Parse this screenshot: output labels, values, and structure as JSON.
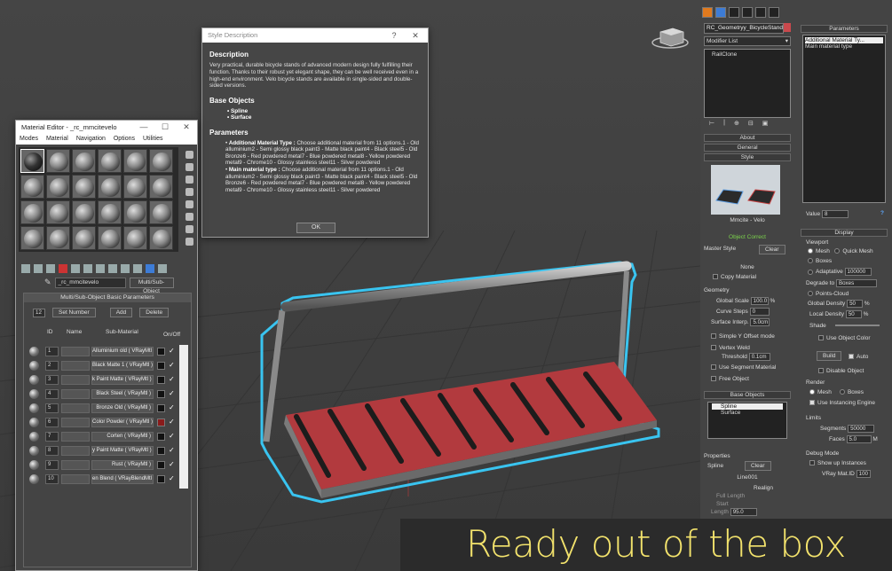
{
  "style_dialog": {
    "title": "Style Description",
    "help": "?",
    "close": "✕",
    "description_heading": "Description",
    "description": "Very practical, durable bicycle stands of advanced modern design fully fulfilling their function. Thanks to their robust yet elegant shape, they can be well received even in a high-end environment. Velo bicycle stands are available in single-sided and double-sided versions.",
    "base_objects_heading": "Base Objects",
    "base_objects": [
      "Spline",
      "Surface"
    ],
    "parameters_heading": "Parameters",
    "param1_name": "Additional Material Type :",
    "param1_text": " Choose additional material from 11 options.1 - Old alluminium2 - Semi glossy black paint3 - Matte black paint4 - Black steel5 - Old Bronze6 - Red powdered metal7 - Blue powdered metal8 - Yellow powdered metal9 - Chrome10 - Glossy stainless steel11 - Silver powdered",
    "param2_name": "Main material type :",
    "param2_text": " Choose additional material from 11 options.1 - Old alluminium2 - Semi glossy black paint3 - Matte black paint4 - Black steel5 - Old Bronze6 - Red powdered metal7 - Blue powdered metal8 - Yellow powdered metal9 - Chrome10 - Glossy stainless steel11 - Silver powdered",
    "ok": "OK"
  },
  "material_editor": {
    "title": "Material Editor - _rc_mmcitevelo",
    "min": "—",
    "max": "☐",
    "close": "✕",
    "menu": [
      "Modes",
      "Material",
      "Navigation",
      "Options",
      "Utilities"
    ],
    "material_name": "_rc_mmcitevelo",
    "material_type": "Multi/Sub-Object",
    "rollout_title": "Multi/Sub-Object Basic Parameters",
    "count": "12",
    "set_number": "Set Number",
    "add": "Add",
    "delete": "Delete",
    "col_id": "ID",
    "col_name": "Name",
    "col_sub": "Sub-Material",
    "col_onoff": "On/Off",
    "rows": [
      {
        "id": "1",
        "sub": "Alluminium old  ( VRayMtl )",
        "color": "#111111"
      },
      {
        "id": "2",
        "sub": "Black Matte 1  ( VRayMtl )",
        "color": "#111111"
      },
      {
        "id": "3",
        "sub": "k Paint Matte  ( VRayMtl )",
        "color": "#111111"
      },
      {
        "id": "4",
        "sub": "Black Steel  ( VRayMtl )",
        "color": "#111111"
      },
      {
        "id": "5",
        "sub": "Bronze Old  ( VRayMtl )",
        "color": "#111111"
      },
      {
        "id": "6",
        "sub": "Color Powder  ( VRayMtl )",
        "color": "#8a1b1b"
      },
      {
        "id": "7",
        "sub": "Corten  ( VRayMtl )",
        "color": "#111111"
      },
      {
        "id": "8",
        "sub": "y Paint Matte  ( VRayMtl )",
        "color": "#111111"
      },
      {
        "id": "9",
        "sub": "Rust  ( VRayMtl )",
        "color": "#111111"
      },
      {
        "id": "10",
        "sub": "en Blend  ( VRayBlendMtl )",
        "color": "#111111"
      }
    ]
  },
  "modifier_panel": {
    "object_name": "RC_Geometryy_BicycleStand",
    "modifier_list": "Modifier List",
    "stack_item": "RailClone",
    "about": "About",
    "general": "General",
    "style": "Style",
    "style_name": "Mmcite - Velo",
    "object_correct": "Object Correct",
    "master_style": "Master Style",
    "clear": "Clear",
    "none": "None",
    "copy_material": "Copy Material",
    "geometry": "Geometry",
    "global_scale_label": "Global Scale",
    "global_scale": "100.0",
    "pct": "%",
    "curve_steps_label": "Curve Steps",
    "curve_steps": "0",
    "surface_interp_label": "Surface Interp.",
    "surface_interp": "5.0cm",
    "simple_y": "Simple Y Offset mode",
    "vertex_weld": "Vertex Weld",
    "threshold_label": "Threshold",
    "threshold": "0.1cm",
    "use_segment_material": "Use Segment Material",
    "free_object": "Free Object",
    "base_objects": "Base Objects",
    "spline": "Spline",
    "surface": "Surface",
    "properties": "Properties",
    "prop_spline": "Spline",
    "prop_clear": "Clear",
    "line_name": "Line001",
    "realign": "Realign",
    "full_length": "Full Length",
    "start": "Start",
    "length": "Length",
    "length_value": "95.0"
  },
  "params_panel": {
    "title": "Parameters",
    "items": [
      "Additional Material Ty...",
      "Main material type"
    ],
    "value_label": "Value",
    "value": "8",
    "display": "Display",
    "viewport": "Viewport",
    "mesh": "Mesh",
    "quick_mesh": "Quick Mesh",
    "boxes": "Boxes",
    "adaptative": "Adaptative",
    "adaptative_value": "100000",
    "degrade_label": "Degrade to",
    "degrade_value": "Boxes",
    "points_cloud": "Points-Cloud",
    "global_density_label": "Global Density",
    "global_density": "50",
    "local_density_label": "Local Density",
    "local_density": "50",
    "shade": "Shade",
    "use_object_color": "Use Object Color",
    "build": "Build",
    "auto": "Auto",
    "disable_object": "Disable Object",
    "render": "Render",
    "r_mesh": "Mesh",
    "r_boxes": "Boxes",
    "use_instancing": "Use Instancing Engine",
    "limits": "Limits",
    "segments_label": "Segments",
    "segments": "50000",
    "faces_label": "Faces",
    "faces": "5.0",
    "faces_unit": "M",
    "debug_mode": "Debug Mode",
    "show_up_instances": "Show up Instances",
    "vray_label": "VRay Mat.ID",
    "vray_value": "100"
  },
  "caption": "Ready out of the box"
}
